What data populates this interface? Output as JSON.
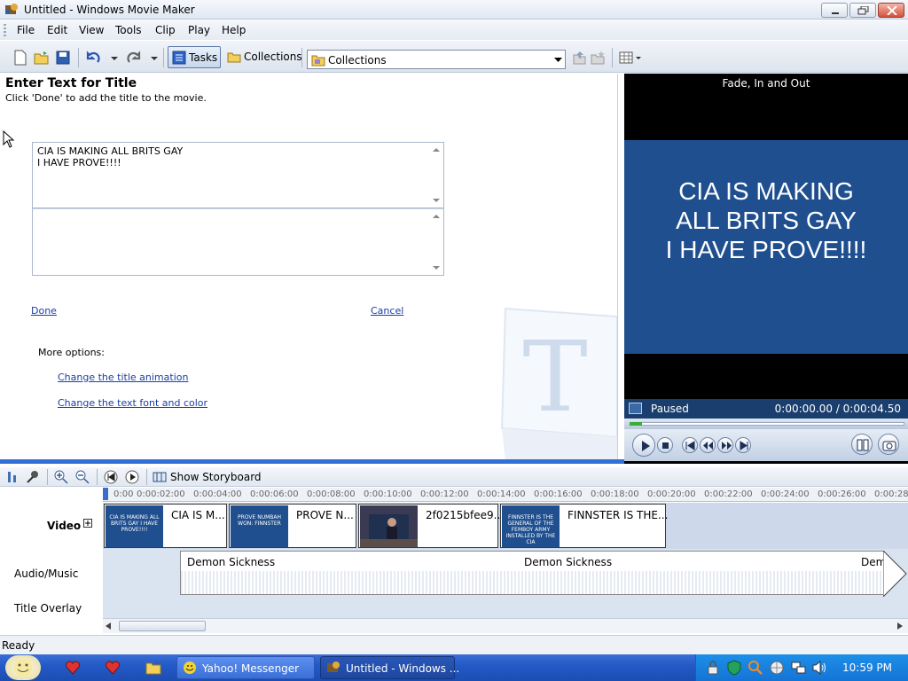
{
  "window": {
    "title": "Untitled - Windows Movie Maker"
  },
  "menu": [
    "File",
    "Edit",
    "View",
    "Tools",
    "Clip",
    "Play",
    "Help"
  ],
  "toolbar": {
    "tasks_label": "Tasks",
    "collections_label": "Collections",
    "collections_dropdown_value": "Collections"
  },
  "editor": {
    "heading": "Enter Text for Title",
    "subheading": "Click 'Done' to add the title to the movie.",
    "title_text_line1": "CIA IS MAKING ALL BRITS GAY",
    "title_text_line2": "I HAVE PROVE!!!!",
    "done_label": "Done",
    "cancel_label": "Cancel",
    "more_options_label": "More options:",
    "change_animation_label": "Change the title animation",
    "change_font_label": "Change the text font and color"
  },
  "preview": {
    "effect_title": "Fade, In and Out",
    "screen_line1": "CIA IS MAKING",
    "screen_line2": "ALL BRITS GAY",
    "screen_line3": "I HAVE PROVE!!!!",
    "state": "Paused",
    "time": "0:00:00.00 / 0:00:04.50",
    "progress": 0.02
  },
  "timeline": {
    "show_storyboard_label": "Show Storyboard",
    "ruler_ticks": [
      "0:00",
      "0:00:02:00",
      "0:00:04:00",
      "0:00:06:00",
      "0:00:08:00",
      "0:00:10:00",
      "0:00:12:00",
      "0:00:14:00",
      "0:00:16:00",
      "0:00:18:00",
      "0:00:20:00",
      "0:00:22:00",
      "0:00:24:00",
      "0:00:26:00",
      "0:00:28"
    ],
    "tracks": {
      "video": "Video",
      "audio": "Audio/Music",
      "overlay": "Title Overlay"
    },
    "video_clips": [
      {
        "name": "CIA IS M...",
        "thumb_text": "CIA IS MAKING ALL BRITS GAY I HAVE PROVE!!!!"
      },
      {
        "name": "PROVE N...",
        "thumb_text": "PROVE NUMBAH WON: FINNSTER"
      },
      {
        "name": "2f0215bfee9...",
        "thumb_text": ""
      },
      {
        "name": "FINNSTER IS THE...",
        "thumb_text": "FINNSTER IS THE GENERAL OF THE FEMBOY ARMY INSTALLED BY THE CIA"
      }
    ],
    "audio_clips": [
      "Demon Sickness",
      "Demon Sickness",
      "Demo"
    ]
  },
  "status": {
    "text": "Ready"
  },
  "taskbar": {
    "yahoo_label": "Yahoo! Messenger",
    "wmm_label": "Untitled - Windows ...",
    "clock": "10:59 PM"
  },
  "colors": {
    "title_blue": "#1f4f8f",
    "taskbar_blue": "#245ac7",
    "link_blue": "#1a3fa6"
  }
}
